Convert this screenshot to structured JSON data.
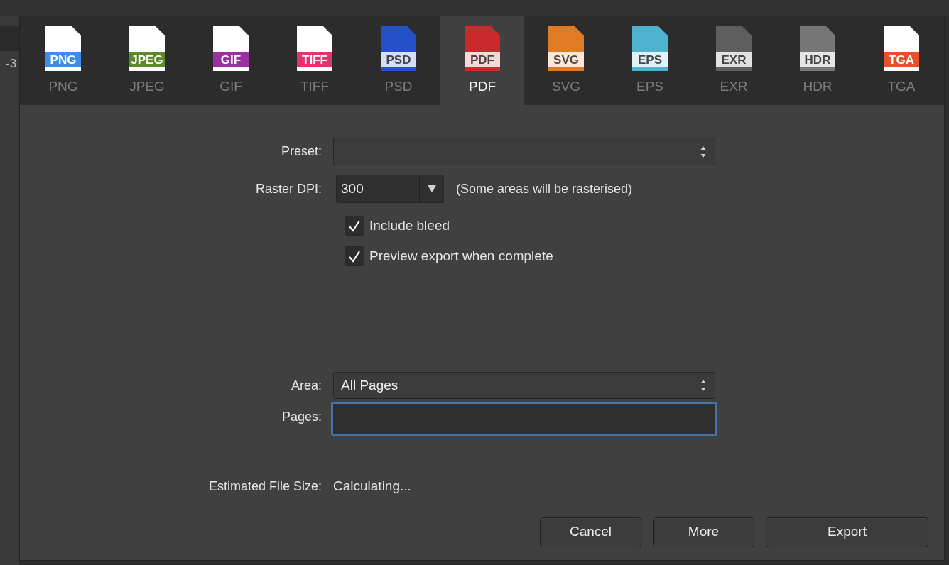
{
  "ruler": {
    "label": "-3"
  },
  "formats": [
    {
      "badge": "PNG",
      "label": "PNG",
      "kind": "white_page",
      "color": "#3d8ee6",
      "selected": false
    },
    {
      "badge": "JPEG",
      "label": "JPEG",
      "kind": "white_page",
      "color": "#5f8a2a",
      "selected": false
    },
    {
      "badge": "GIF",
      "label": "GIF",
      "kind": "white_page",
      "color": "#9a2fa0",
      "selected": false
    },
    {
      "badge": "TIFF",
      "label": "TIFF",
      "kind": "white_page",
      "color": "#e5336f",
      "selected": false
    },
    {
      "badge": "PSD",
      "label": "PSD",
      "kind": "colored_page",
      "color": "#2450c8",
      "selected": false
    },
    {
      "badge": "PDF",
      "label": "PDF",
      "kind": "colored_page",
      "color": "#c92a2a",
      "selected": true
    },
    {
      "badge": "SVG",
      "label": "SVG",
      "kind": "colored_page",
      "color": "#e07a25",
      "selected": false
    },
    {
      "badge": "EPS",
      "label": "EPS",
      "kind": "colored_page",
      "color": "#4fb3d0",
      "selected": false
    },
    {
      "badge": "EXR",
      "label": "EXR",
      "kind": "colored_page",
      "color": "#5e5e5e",
      "selected": false
    },
    {
      "badge": "HDR",
      "label": "HDR",
      "kind": "colored_page",
      "color": "#767676",
      "selected": false
    },
    {
      "badge": "TGA",
      "label": "TGA",
      "kind": "white_page",
      "color": "#e8502a",
      "selected": false
    }
  ],
  "preset": {
    "label": "Preset:"
  },
  "raster_dpi": {
    "label": "Raster DPI:",
    "value": "300",
    "note": "(Some areas will be rasterised)"
  },
  "options": [
    {
      "label": "Include bleed",
      "checked": true
    },
    {
      "label": "Preview export when complete",
      "checked": true
    }
  ],
  "area": {
    "label": "Area:",
    "value": "All Pages"
  },
  "pages": {
    "label": "Pages:",
    "focused": true
  },
  "estimated_file_size": {
    "label": "Estimated File Size:",
    "value": "Calculating..."
  },
  "buttons": [
    "Cancel",
    "More",
    "Export"
  ]
}
